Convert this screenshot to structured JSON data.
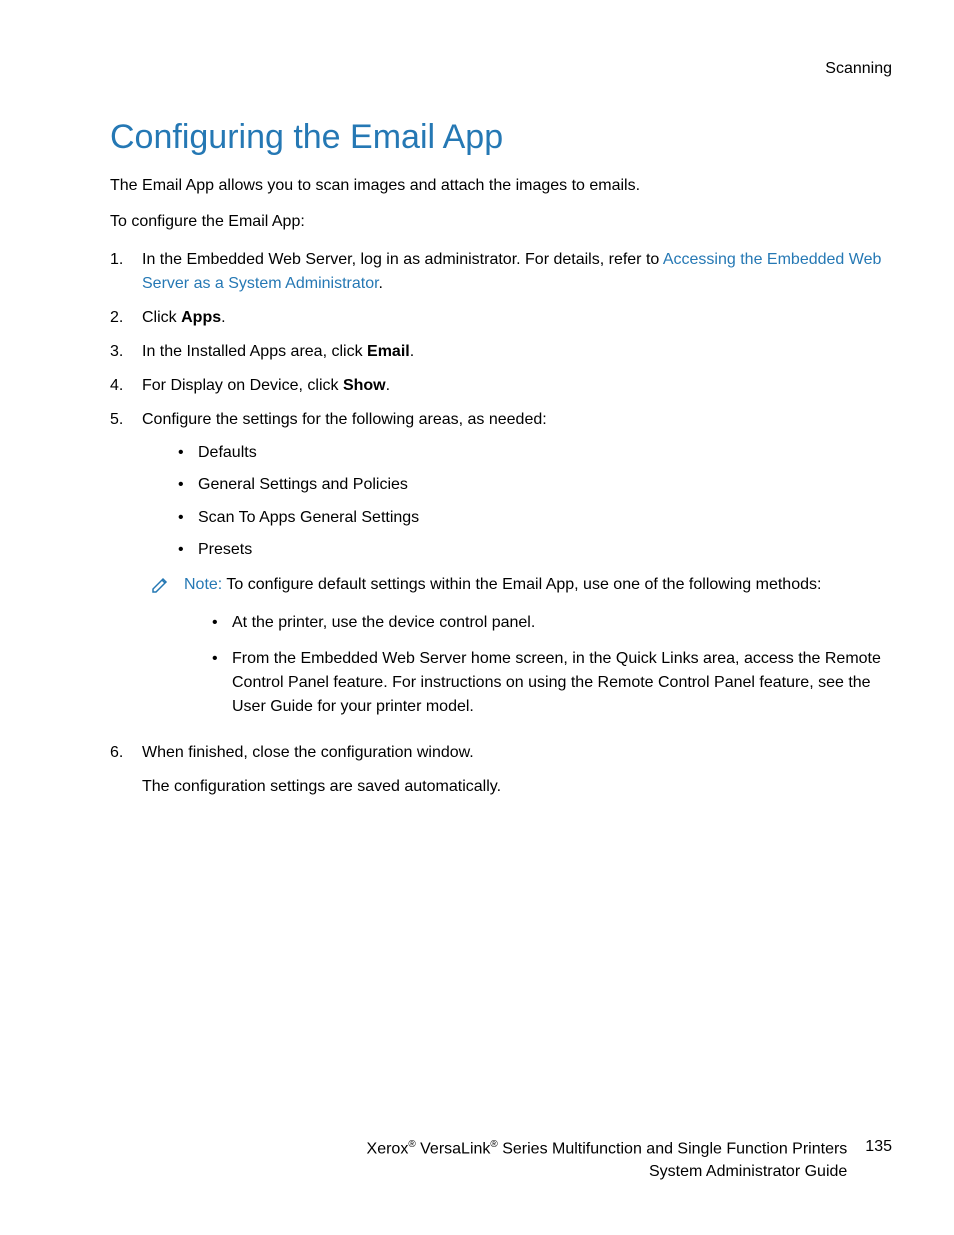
{
  "header": {
    "section_label": "Scanning"
  },
  "main": {
    "heading": "Configuring the Email App",
    "intro": "The Email App allows you to scan images and attach the images to emails.",
    "lead_in": "To configure the Email App:",
    "steps": {
      "s1_prefix": "In the Embedded Web Server, log in as administrator. For details, refer to ",
      "s1_link": "Accessing the Embedded Web Server as a System Administrator",
      "s1_suffix": ".",
      "s2_prefix": "Click ",
      "s2_bold": "Apps",
      "s2_suffix": ".",
      "s3_prefix": "In the Installed Apps area, click ",
      "s3_bold": "Email",
      "s3_suffix": ".",
      "s4_prefix": "For Display on Device, click ",
      "s4_bold": "Show",
      "s4_suffix": ".",
      "s5": "Configure the settings for the following areas, as needed:",
      "s5_bullets": {
        "b1": "Defaults",
        "b2": "General Settings and Policies",
        "b3": "Scan To Apps General Settings",
        "b4": "Presets"
      },
      "note": {
        "label": "Note:",
        "text": " To configure default settings within the Email App, use one of the following methods:",
        "bullets": {
          "n1": "At the printer, use the device control panel.",
          "n2": "From the Embedded Web Server home screen, in the Quick Links area, access the Remote Control Panel feature. For instructions on using the Remote Control Panel feature, see the User Guide for your printer model."
        }
      },
      "s6": "When finished, close the configuration window.",
      "s6_follow": "The configuration settings are saved automatically."
    }
  },
  "footer": {
    "line1_a": "Xerox",
    "line1_b": " VersaLink",
    "line1_c": " Series Multifunction and Single Function Printers",
    "line2": "System Administrator Guide",
    "page_number": "135",
    "reg": "®"
  }
}
